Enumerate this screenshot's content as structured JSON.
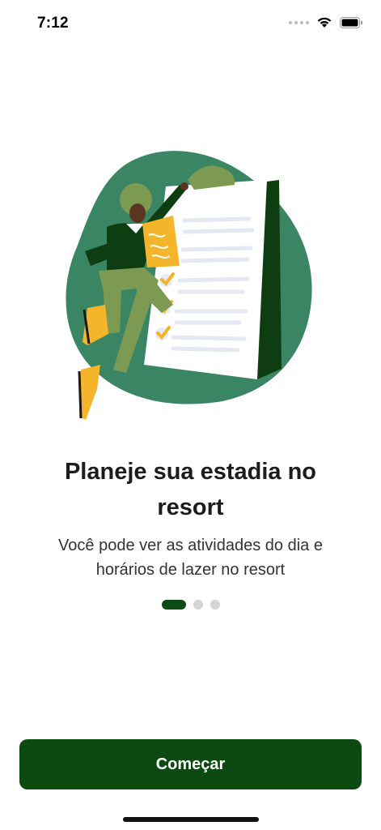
{
  "status": {
    "time": "7:12",
    "icons": [
      "signal-icon",
      "wifi-icon",
      "battery-icon"
    ]
  },
  "onboarding": {
    "illustration": "person-holding-checklist-illustration",
    "title": "Planeje sua estadia no resort",
    "subtitle": "Você pode ver as atividades do dia e horários de lazer no resort",
    "pages_total": 3,
    "current_page": 1
  },
  "actions": {
    "start_label": "Começar"
  },
  "colors": {
    "primary": "#0d4a12",
    "blob": "#3a8564",
    "accent": "#f5b52b",
    "inactive_dot": "#d4d4d4"
  }
}
